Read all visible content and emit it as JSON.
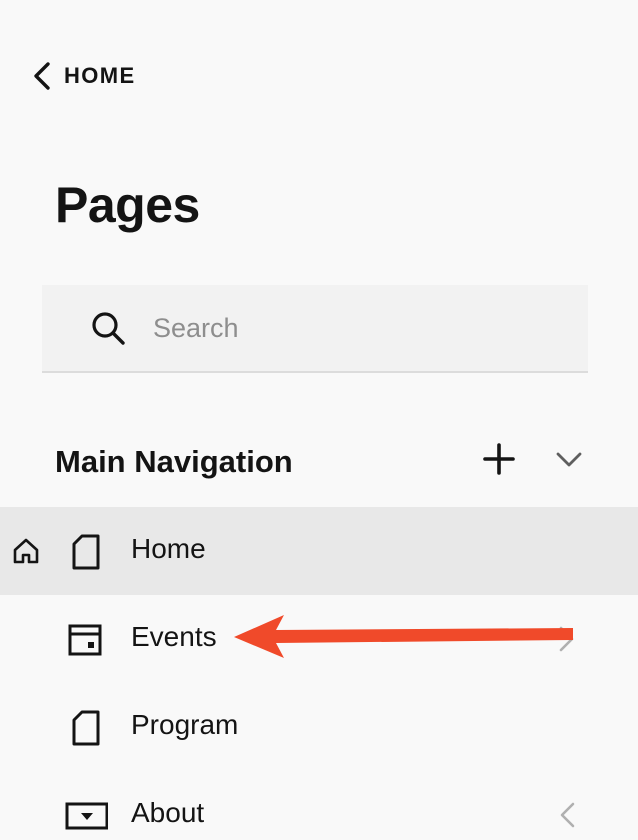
{
  "header": {
    "back_label": "HOME",
    "title": "Pages"
  },
  "search": {
    "placeholder": "Search",
    "value": ""
  },
  "section": {
    "title": "Main Navigation"
  },
  "nav_items": [
    {
      "label": "Home",
      "icon": "page-icon",
      "selected": true,
      "is_homepage": true
    },
    {
      "label": "Events",
      "icon": "events-page-icon",
      "selected": false
    },
    {
      "label": "Program",
      "icon": "page-icon",
      "selected": false
    },
    {
      "label": "About",
      "icon": "folder-icon",
      "selected": false
    }
  ],
  "colors": {
    "background": "#f9f9f9",
    "selected_row": "#e8e8e8",
    "search_bg": "#f2f2f2",
    "text": "#141414",
    "annotation_arrow": "#f04a2a"
  }
}
